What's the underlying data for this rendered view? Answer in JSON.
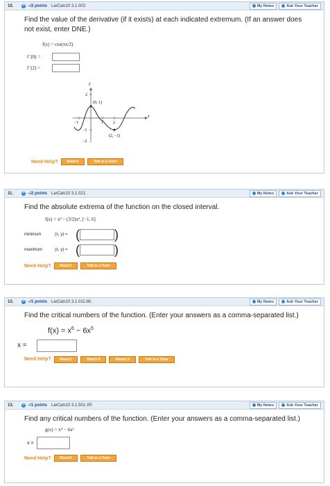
{
  "common": {
    "my_notes": "My Notes",
    "ask_teacher": "Ask Your Teacher",
    "need_help": "Need Help?",
    "read_it": "Read It",
    "talk_tutor": "Talk to a Tutor",
    "watch_it": "Watch It",
    "master_it": "Master It"
  },
  "q10": {
    "number": "10.",
    "points": "–/2 points",
    "source": "LarCalc10 3.1.002.",
    "prompt": "Find the value of the derivative (if it exists) at each indicated extremum. (If an answer does not exist, enter DNE.)",
    "function": "f(x) = cos(πx/2)",
    "fp0_label": "f '(0) =",
    "fp2_label": "f '(2) =",
    "graph": {
      "y_label": "y",
      "x_label": "x",
      "tick_y_pos": "2",
      "tick_y_neg1": "−1",
      "tick_y_neg2": "−2",
      "tick_x1": "1",
      "tick_x2": "2",
      "tick_xneg1": "−1",
      "point_a": "(0, 1)",
      "point_b": "(2, −1)"
    }
  },
  "q11": {
    "number": "11.",
    "points": "–/2 points",
    "source": "LarCalc10 3.1.021.",
    "prompt": "Find the absolute extrema of the function on the closed interval.",
    "function": "f(x) = x³ − (3/2)x², [−1, 6]",
    "min_label": "minimum",
    "max_label": "maximum",
    "xy_label": "(x, y) ="
  },
  "q12": {
    "number": "12.",
    "points": "–/1 points",
    "source": "LarCalc10 3.1.011.MI.",
    "prompt": "Find the critical numbers of the function. (Enter your answers as a comma-separated list.)",
    "function_prefix": "f(x) = x",
    "function_exp1": "6",
    "function_mid": " − 6x",
    "function_exp2": "5",
    "x_label": "x ="
  },
  "q13": {
    "number": "13.",
    "points": "–/1 points",
    "source": "LarCalc10 3.1.501.XP.",
    "prompt": "Find any critical numbers of the function. (Enter your answers as a comma-separated list.)",
    "function": "g(x) = x⁴ − 6x²",
    "x_label": "x ="
  }
}
